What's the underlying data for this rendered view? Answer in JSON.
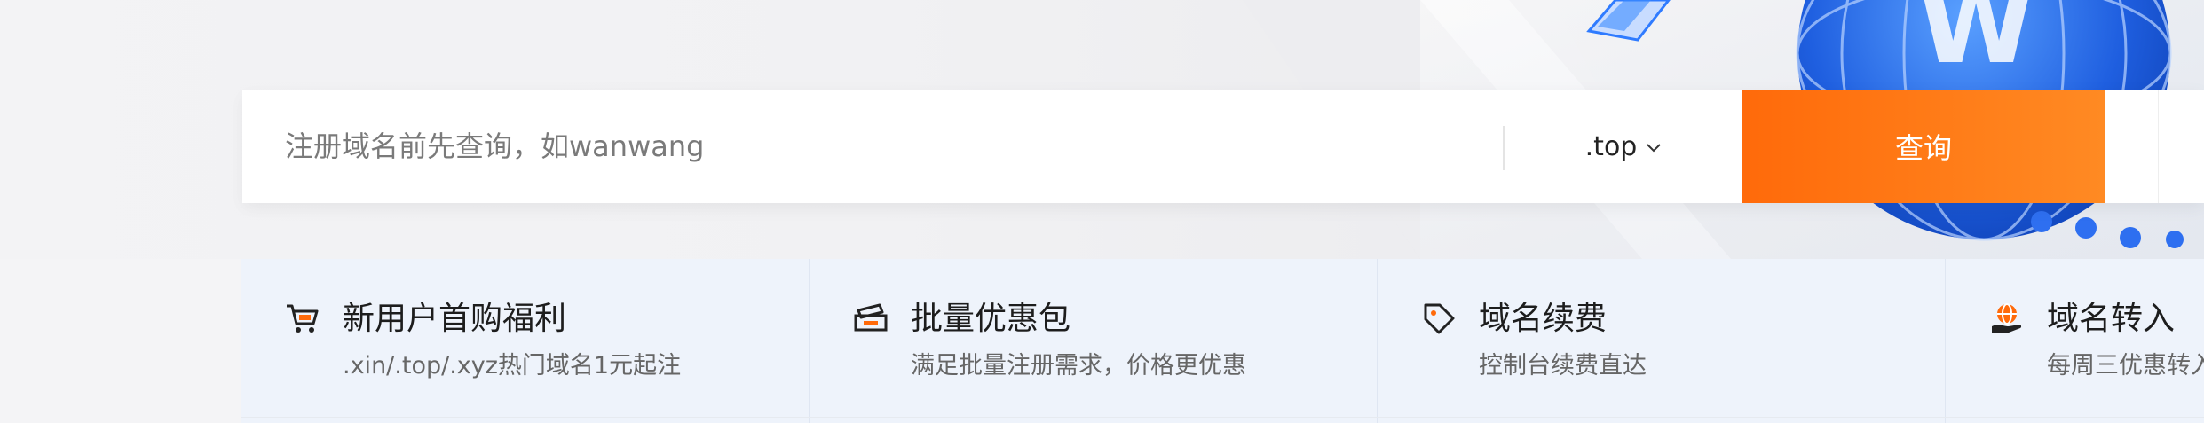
{
  "search": {
    "placeholder": "注册域名前先查询，如wanwang",
    "tld": ".top",
    "button_label": "查询"
  },
  "features": [
    {
      "title": "新用户首购福利",
      "description": ".xin/.top/.xyz热门域名1元起注",
      "icon": "cart-icon"
    },
    {
      "title": "批量优惠包",
      "description": "满足批量注册需求，价格更优惠",
      "icon": "ticket-icon"
    },
    {
      "title": "域名续费",
      "description": "控制台续费直达",
      "icon": "tag-icon"
    },
    {
      "title": "域名转入",
      "description": "每周三优惠转入",
      "icon": "globe-hand-icon"
    }
  ],
  "colors": {
    "accent": "#ff6a0a",
    "feature_bg": "#eef3fb",
    "hero_bg": "#f3f3f5",
    "globe_blue": "#1f5fe0"
  }
}
